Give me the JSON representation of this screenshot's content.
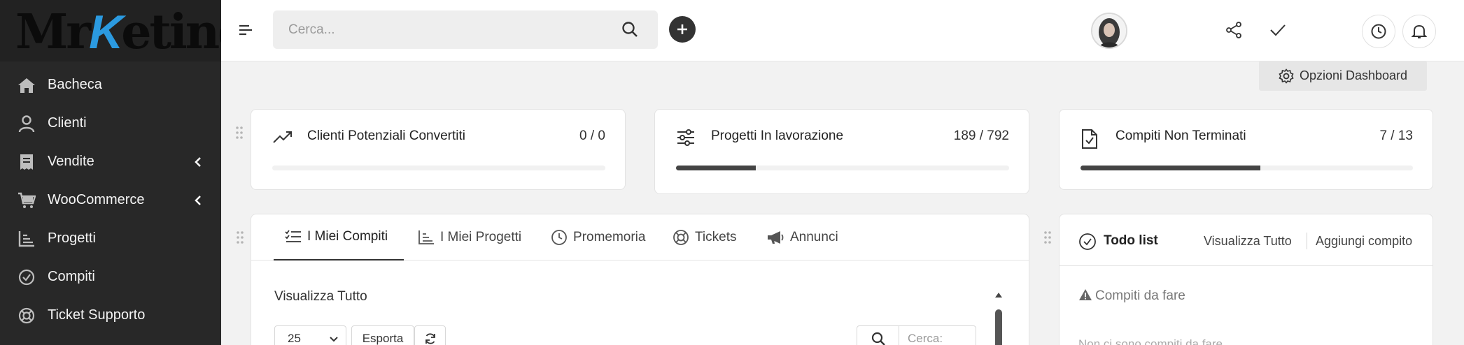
{
  "brand": {
    "logo_text_a": "Mr",
    "logo_text_k": "K",
    "logo_text_b": "eting"
  },
  "sidebar": {
    "items": [
      {
        "label": "Bacheca",
        "icon": "home-icon"
      },
      {
        "label": "Clienti",
        "icon": "user-icon"
      },
      {
        "label": "Vendite",
        "icon": "receipt-icon",
        "has_submenu": true
      },
      {
        "label": "WooCommerce",
        "icon": "cart-icon",
        "has_submenu": true
      },
      {
        "label": "Progetti",
        "icon": "chart-icon"
      },
      {
        "label": "Compiti",
        "icon": "check-circle-icon"
      },
      {
        "label": "Ticket Supporto",
        "icon": "lifebuoy-icon"
      }
    ]
  },
  "topbar": {
    "search_placeholder": "Cerca...",
    "icons": [
      "menu-icon",
      "search-icon",
      "plus-icon",
      "share-icon",
      "check-icon",
      "avatar",
      "clock-icon",
      "bell-icon"
    ]
  },
  "dashboard": {
    "options_label": "Opzioni Dashboard"
  },
  "stats": [
    {
      "title": "Clienti Potenziali Convertiti",
      "value": "0 / 0",
      "progress": 0,
      "icon": "trending-up-icon"
    },
    {
      "title": "Progetti In lavorazione",
      "value": "189 / 792",
      "progress": 0.24,
      "icon": "sliders-icon"
    },
    {
      "title": "Compiti Non Terminati",
      "value": "7 / 13",
      "progress": 0.54,
      "icon": "file-check-icon"
    }
  ],
  "tasks_panel": {
    "tabs": [
      {
        "label": "I Miei Compiti",
        "icon": "tasks-icon",
        "active": true
      },
      {
        "label": "I Miei Progetti",
        "icon": "chart-icon",
        "active": false
      },
      {
        "label": "Promemoria",
        "icon": "clock-icon",
        "active": false
      },
      {
        "label": "Tickets",
        "icon": "lifebuoy-icon",
        "active": false
      },
      {
        "label": "Annunci",
        "icon": "megaphone-icon",
        "active": false
      }
    ],
    "view_all": "Visualizza Tutto",
    "page_size": "25",
    "export_label": "Esporta",
    "search_placeholder": "Cerca:"
  },
  "todo": {
    "title": "Todo list",
    "view_all": "Visualizza Tutto",
    "add_task": "Aggiungi compito",
    "section_title": "Compiti da fare",
    "empty_text": "Non ci sono compiti da fare"
  },
  "colors": {
    "sidebar": "#282828",
    "accent": "#2b9ae0",
    "progress": "#444444"
  }
}
